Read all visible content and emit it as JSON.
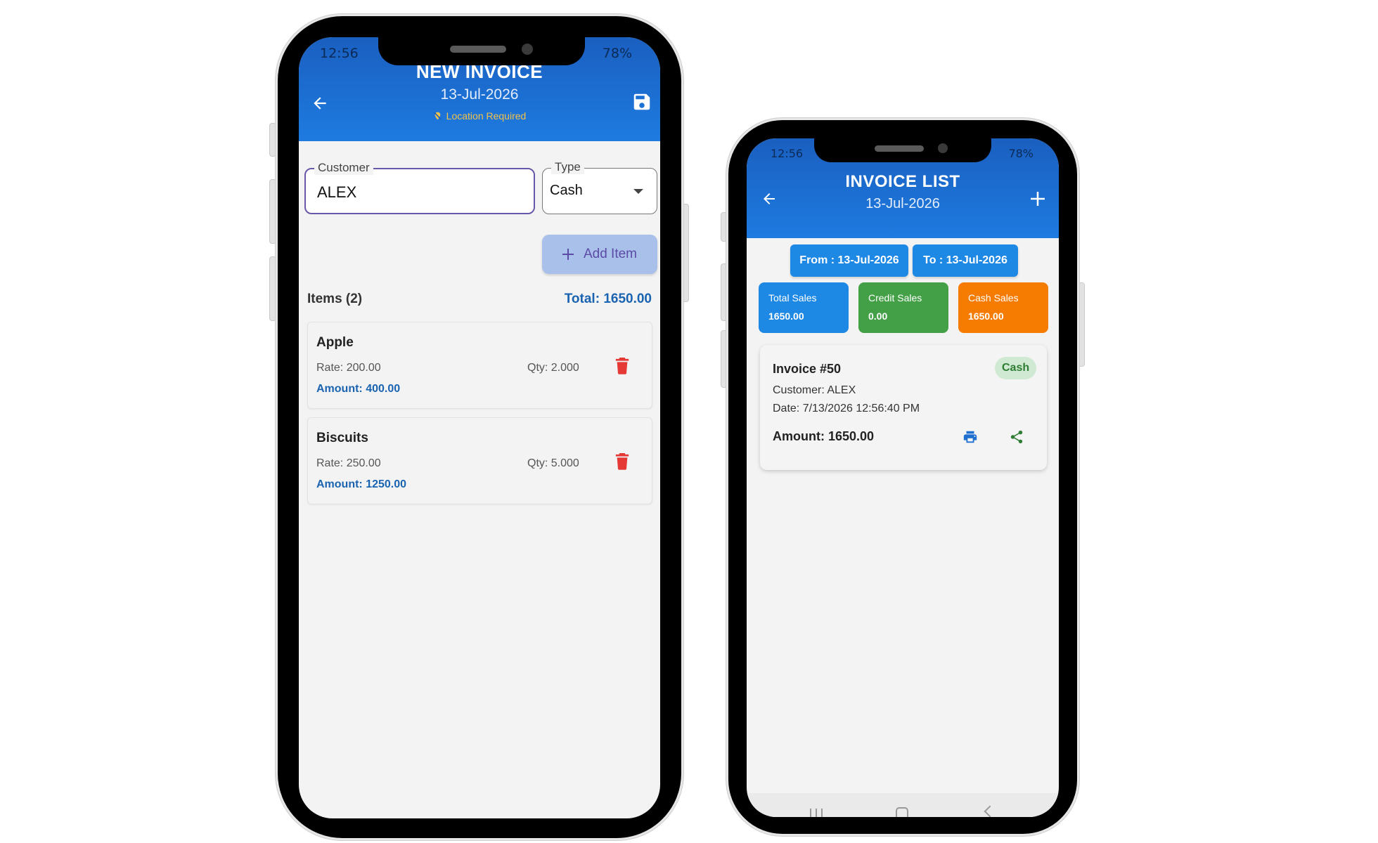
{
  "new_invoice": {
    "status": {
      "time": "12:56",
      "battery": "78%"
    },
    "header": {
      "title": "NEW INVOICE",
      "date": "13-Jul-2026",
      "location": "Location Required"
    },
    "customer": {
      "label": "Customer",
      "value": "ALEX"
    },
    "type": {
      "label": "Type",
      "value": "Cash"
    },
    "add_item_label": "Add Item",
    "items_count_label": "Items (2)",
    "total_label": "Total: 1650.00",
    "items": [
      {
        "name": "Apple",
        "rate": "Rate: 200.00",
        "qty": "Qty: 2.000",
        "amount": "Amount: 400.00"
      },
      {
        "name": "Biscuits",
        "rate": "Rate: 250.00",
        "qty": "Qty: 5.000",
        "amount": "Amount: 1250.00"
      }
    ]
  },
  "invoice_list": {
    "status": {
      "time": "12:56",
      "battery": "78%"
    },
    "header": {
      "title": "INVOICE LIST",
      "date": "13-Jul-2026"
    },
    "from_label": "From : 13-Jul-2026",
    "to_label": "To : 13-Jul-2026",
    "stats": [
      {
        "label": "Total Sales",
        "value": "1650.00",
        "color": "#1e88e5"
      },
      {
        "label": "Credit Sales",
        "value": "0.00",
        "color": "#43a047"
      },
      {
        "label": "Cash Sales",
        "value": "1650.00",
        "color": "#f57c00"
      }
    ],
    "invoice": {
      "title": "Invoice #50",
      "badge": "Cash",
      "customer": "Customer: ALEX",
      "date": "Date: 7/13/2026 12:56:40 PM",
      "amount": "Amount: 1650.00"
    }
  },
  "colors": {
    "primary": "#1e7be0",
    "danger": "#e53935",
    "accent_text": "#1a63b0",
    "location_warning": "#f2c24b"
  },
  "icons": [
    "back-arrow-icon",
    "save-icon",
    "location-off-icon",
    "dropdown-icon",
    "plus-icon",
    "trash-icon",
    "print-icon",
    "share-icon"
  ]
}
